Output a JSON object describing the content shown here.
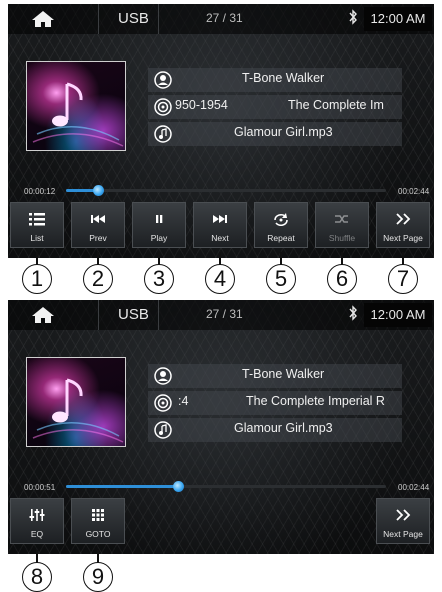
{
  "screens": [
    {
      "source": "USB",
      "track_counter": "27 / 31",
      "clock": "12:00 AM",
      "artist": "T-Bone Walker",
      "album_left": "950-1954",
      "album_right": "The Complete Im",
      "song": "Glamour Girl.mp3",
      "elapsed": "00:00:12",
      "total": "00:02:44",
      "progress": 0.1
    },
    {
      "source": "USB",
      "track_counter": "27 / 31",
      "clock": "12:00 AM",
      "artist": "T-Bone Walker",
      "album_left": ":4",
      "album_right": "The Complete Imperial R",
      "song": "Glamour Girl.mp3",
      "elapsed": "00:00:51",
      "total": "00:02:44",
      "progress": 0.35
    }
  ],
  "buttons_page1": [
    {
      "label": "List",
      "icon": "list-icon"
    },
    {
      "label": "Prev",
      "icon": "previous-track-icon"
    },
    {
      "label": "Play",
      "icon": "pause-icon"
    },
    {
      "label": "Next",
      "icon": "next-track-icon"
    },
    {
      "label": "Repeat",
      "icon": "repeat-icon"
    },
    {
      "label": "Shuffle",
      "icon": "shuffle-icon"
    },
    {
      "label": "Next Page",
      "icon": "double-chevron-right-icon"
    }
  ],
  "buttons_page2": [
    {
      "label": "EQ",
      "icon": "equalizer-icon"
    },
    {
      "label": "GOTO",
      "icon": "keypad-icon"
    },
    {
      "label": "Next Page",
      "icon": "double-chevron-right-icon"
    }
  ],
  "callouts": [
    "1",
    "2",
    "3",
    "4",
    "5",
    "6",
    "7",
    "8",
    "9"
  ],
  "colors": {
    "accent": "#2e8fd8",
    "text": "#f0f0f0"
  }
}
